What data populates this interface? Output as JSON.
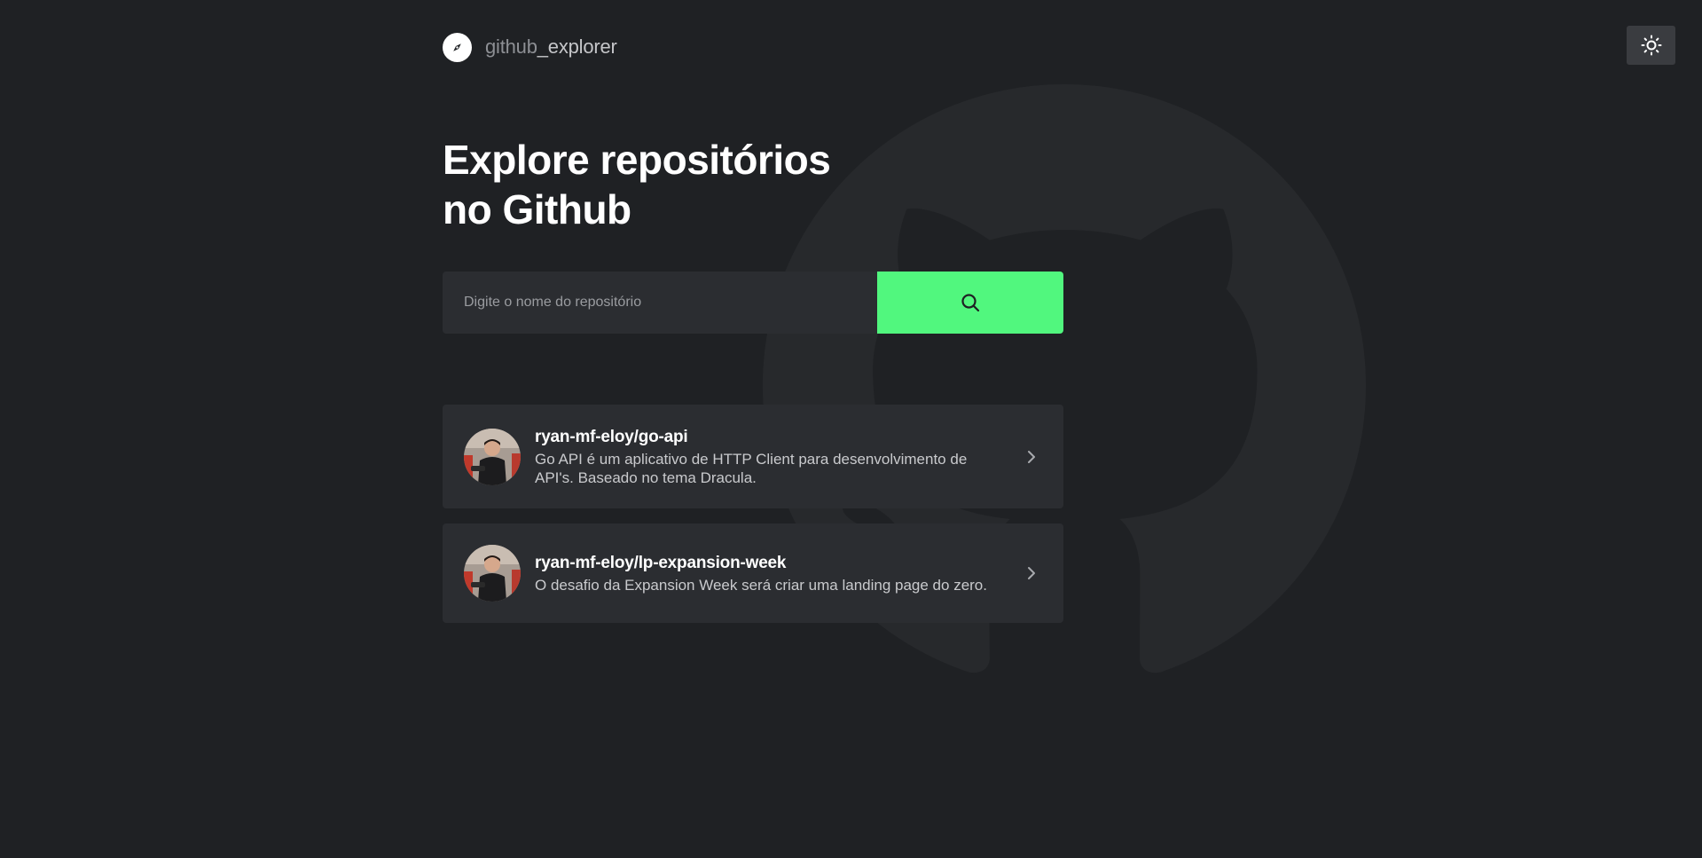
{
  "header": {
    "logo_part1": "github",
    "logo_part2": "_explorer",
    "logo_icon": "compass-icon",
    "theme_toggle_icon": "sun-icon"
  },
  "hero": {
    "title_line1": "Explore repositórios",
    "title_line2": "no Github"
  },
  "search": {
    "placeholder": "Digite o nome do repositório",
    "value": "",
    "button_icon": "search-icon"
  },
  "repositories": [
    {
      "name": "ryan-mf-eloy/go-api",
      "description": "Go API é um aplicativo de HTTP Client para desenvolvimento de API's. Baseado no tema Dracula."
    },
    {
      "name": "ryan-mf-eloy/lp-expansion-week",
      "description": "O desafio da Expansion Week será criar uma landing page do zero."
    }
  ],
  "colors": {
    "background": "#1f2124",
    "card": "#2b2d31",
    "accent": "#51f77e",
    "text": "#ffffff",
    "muted": "#c9cacd"
  }
}
